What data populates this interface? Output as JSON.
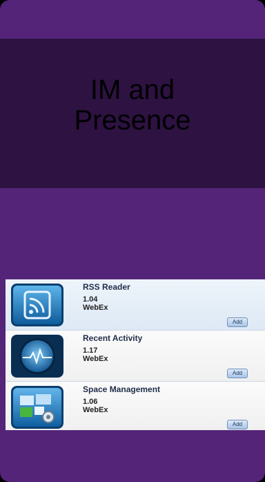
{
  "title": {
    "line1": "IM and",
    "line2": "Presence"
  },
  "apps": [
    {
      "name": "RSS Reader",
      "version": "1.04",
      "vendor": "WebEx",
      "add_label": "Add",
      "icon": "rss-icon"
    },
    {
      "name": "Recent Activity",
      "version": "1.17",
      "vendor": "WebEx",
      "add_label": "Add",
      "icon": "activity-icon"
    },
    {
      "name": "Space Management",
      "version": "1.06",
      "vendor": "WebEx",
      "add_label": "Add",
      "icon": "space-management-icon"
    }
  ],
  "colors": {
    "background": "#532478",
    "band": "#2d1242",
    "accent": "#1e7fc4"
  }
}
